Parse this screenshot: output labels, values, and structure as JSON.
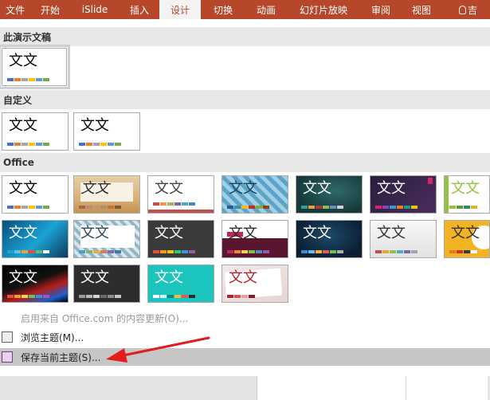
{
  "ribbon": {
    "tabs": [
      {
        "label": "文件",
        "active": false
      },
      {
        "label": "开始",
        "active": false
      },
      {
        "label": "iSlide",
        "active": false
      },
      {
        "label": "插入",
        "active": false
      },
      {
        "label": "设计",
        "active": true
      },
      {
        "label": "切换",
        "active": false
      },
      {
        "label": "动画",
        "active": false
      },
      {
        "label": "幻灯片放映",
        "active": false
      },
      {
        "label": "审阅",
        "active": false
      },
      {
        "label": "视图",
        "active": false
      }
    ],
    "tell_me": "吉",
    "accent_color": "#b7472a"
  },
  "gallery": {
    "thumb_title": "文文",
    "sections": {
      "current": "此演示文稿",
      "custom": "自定义",
      "office": "Office"
    }
  },
  "menu": {
    "update_label": "启用来自 Office.com 的内容更新(O)...",
    "browse_label": "浏览主题(M)...",
    "save_label": "保存当前主题(S)..."
  }
}
